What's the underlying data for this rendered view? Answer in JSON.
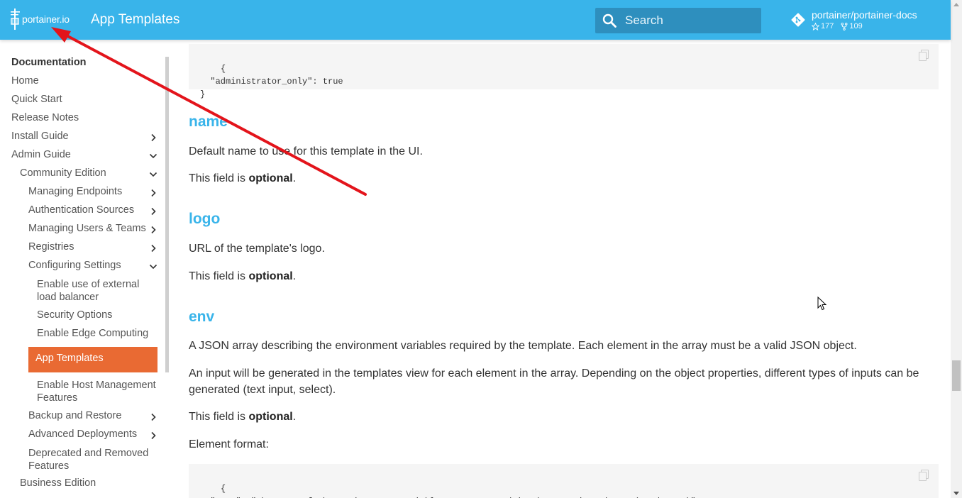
{
  "header": {
    "logo_text": "portainer.io",
    "title": "App Templates",
    "search_placeholder": "Search",
    "repo_name": "portainer/portainer-docs",
    "stars": "177",
    "forks": "109",
    "bg_color": "#39b4ea"
  },
  "sidebar": {
    "title": "Documentation",
    "items": [
      {
        "label": "Home"
      },
      {
        "label": "Quick Start"
      },
      {
        "label": "Release Notes"
      },
      {
        "label": "Install Guide",
        "chevron": "right"
      },
      {
        "label": "Admin Guide",
        "chevron": "down"
      },
      {
        "label": "Community Edition",
        "chevron": "down"
      },
      {
        "label": "Managing Endpoints",
        "chevron": "right"
      },
      {
        "label": "Authentication Sources",
        "chevron": "right"
      },
      {
        "label": "Managing Users & Teams",
        "chevron": "right"
      },
      {
        "label": "Registries",
        "chevron": "right"
      },
      {
        "label": "Configuring Settings",
        "chevron": "down"
      },
      {
        "label": "Enable use of external load balancer"
      },
      {
        "label": "Security Options"
      },
      {
        "label": "Enable Edge Computing"
      },
      {
        "label": "App Templates",
        "active": true
      },
      {
        "label": "Enable Host Management Features"
      },
      {
        "label": "Backup and Restore",
        "chevron": "right"
      },
      {
        "label": "Advanced Deployments",
        "chevron": "right"
      },
      {
        "label": "Deprecated and Removed Features"
      },
      {
        "label": "Business Edition"
      }
    ],
    "active_color": "#e96a33"
  },
  "content": {
    "code1": "{\n  \"administrator_only\": true\n}",
    "sections": [
      {
        "heading": "name",
        "desc": "Default name to use for this template in the UI.",
        "optional_prefix": "This field is ",
        "optional_word": "optional",
        "optional_suffix": "."
      },
      {
        "heading": "logo",
        "desc": "URL of the template's logo.",
        "optional_prefix": "This field is ",
        "optional_word": "optional",
        "optional_suffix": "."
      },
      {
        "heading": "env",
        "desc": "A JSON array describing the environment variables required by the template. Each element in the array must be a valid JSON object.",
        "desc2": "An input will be generated in the templates view for each element in the array. Depending on the object properties, different types of inputs can be generated (text input, select).",
        "optional_prefix": "This field is ",
        "optional_word": "optional",
        "optional_suffix": ".",
        "element_format": "Element format:"
      }
    ],
    "code2": "{\n  \"name\": \"the name of the environment variable, as supported in the container image (mandatory)\",",
    "heading_color": "#39b4ea"
  },
  "annotation": {
    "color": "#e3141b"
  }
}
